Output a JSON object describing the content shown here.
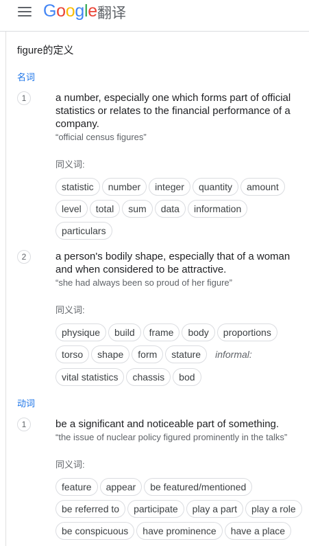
{
  "header": {
    "logo_letters": [
      "G",
      "o",
      "o",
      "g",
      "l",
      "e"
    ],
    "product": "翻译",
    "menu_icon": "hamburger-menu-icon"
  },
  "definition_heading": "figure的定义",
  "noun": {
    "pos_label": "名词",
    "senses": [
      {
        "number": "1",
        "gloss": "a number, especially one which forms part of official statistics or relates to the financial performance of a company.",
        "example": "“official census figures”",
        "synonyms_label": "同义词:",
        "synonyms": [
          "statistic",
          "number",
          "integer",
          "quantity",
          "amount",
          "level",
          "total",
          "sum",
          "data",
          "information",
          "particulars"
        ]
      },
      {
        "number": "2",
        "gloss": "a person's bodily shape, especially that of a woman and when considered to be attractive.",
        "example": "“she had always been so proud of her figure”",
        "synonyms_label": "同义词:",
        "synonyms": [
          "physique",
          "build",
          "frame",
          "body",
          "proportions",
          "torso",
          "shape",
          "form",
          "stature"
        ],
        "register_label": "informal:",
        "informal_synonyms": [
          "vital statistics",
          "chassis",
          "bod"
        ]
      }
    ]
  },
  "verb": {
    "pos_label": "动词",
    "senses": [
      {
        "number": "1",
        "gloss": "be a significant and noticeable part of something.",
        "example": "“the issue of nuclear policy figured prominently in the talks”",
        "synonyms_label": "同义词:",
        "synonyms": [
          "feature",
          "appear",
          "be featured/mentioned",
          "be referred to",
          "participate",
          "play a part",
          "play a role",
          "be conspicuous",
          "have prominence",
          "have a place"
        ]
      }
    ]
  }
}
